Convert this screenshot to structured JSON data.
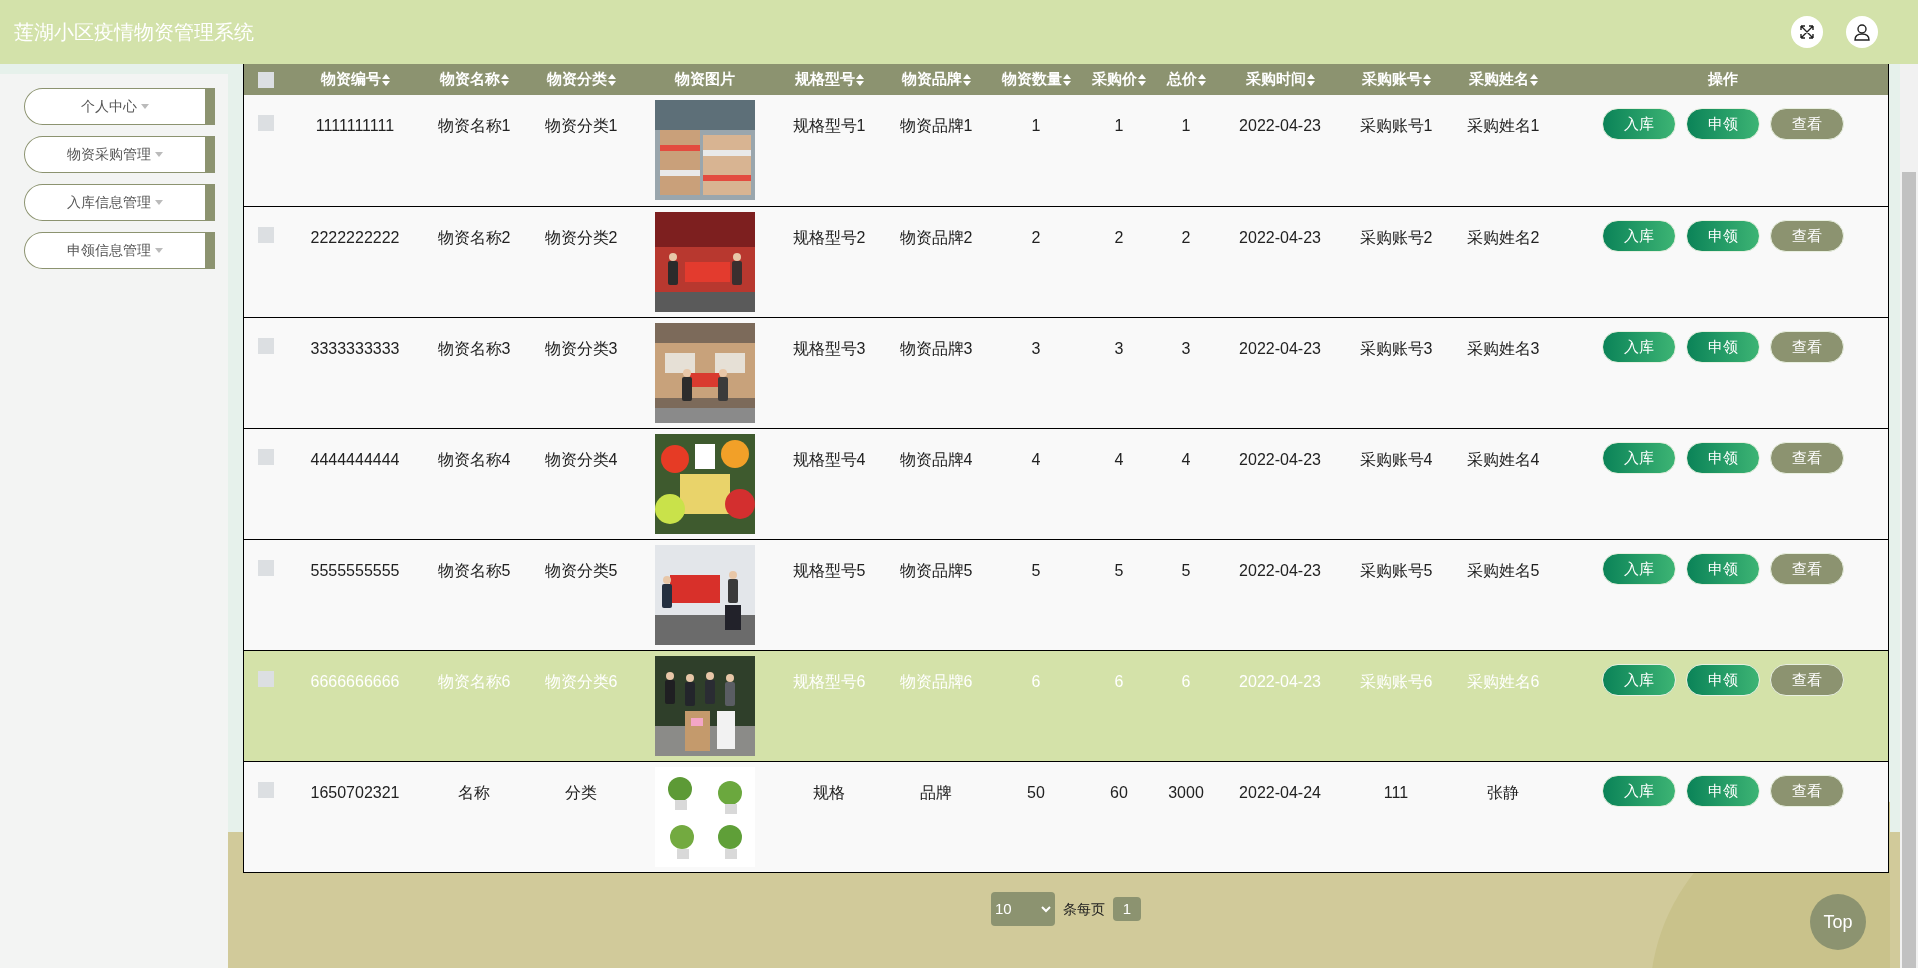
{
  "header": {
    "title": "莲湖小区疫情物资管理系统"
  },
  "sidebar": {
    "items": [
      {
        "label": "个人中心"
      },
      {
        "label": "物资采购管理"
      },
      {
        "label": "入库信息管理"
      },
      {
        "label": "申领信息管理"
      }
    ]
  },
  "table": {
    "select_all": {
      "checked": false
    },
    "columns": [
      {
        "label": "物资编号",
        "sortable": true
      },
      {
        "label": "物资名称",
        "sortable": true
      },
      {
        "label": "物资分类",
        "sortable": true
      },
      {
        "label": "物资图片",
        "sortable": false
      },
      {
        "label": "规格型号",
        "sortable": true
      },
      {
        "label": "物资品牌",
        "sortable": true
      },
      {
        "label": "物资数量",
        "sortable": true
      },
      {
        "label": "采购价",
        "sortable": true
      },
      {
        "label": "总价",
        "sortable": true
      },
      {
        "label": "采购时间",
        "sortable": true
      },
      {
        "label": "采购账号",
        "sortable": true
      },
      {
        "label": "采购姓名",
        "sortable": true
      },
      {
        "label": "操作",
        "sortable": false
      }
    ],
    "rows": [
      {
        "checked": false,
        "highlighted": false,
        "cells": [
          "1111111111",
          "物资名称1",
          "物资分类1",
          {
            "kind": "picture"
          },
          "规格型号1",
          "物资品牌1",
          "1",
          "1",
          "1",
          "2022-04-23",
          "采购账号1",
          "采购姓名1"
        ],
        "actions": [
          {
            "label": "入库",
            "kind": "primary"
          },
          {
            "label": "申领",
            "kind": "primary"
          },
          {
            "label": "查看",
            "kind": "secondary"
          }
        ]
      },
      {
        "checked": false,
        "highlighted": false,
        "cells": [
          "2222222222",
          "物资名称2",
          "物资分类2",
          {
            "kind": "picture"
          },
          "规格型号2",
          "物资品牌2",
          "2",
          "2",
          "2",
          "2022-04-23",
          "采购账号2",
          "采购姓名2"
        ],
        "actions": [
          {
            "label": "入库",
            "kind": "primary"
          },
          {
            "label": "申领",
            "kind": "primary"
          },
          {
            "label": "查看",
            "kind": "secondary"
          }
        ]
      },
      {
        "checked": false,
        "highlighted": false,
        "cells": [
          "3333333333",
          "物资名称3",
          "物资分类3",
          {
            "kind": "picture"
          },
          "规格型号3",
          "物资品牌3",
          "3",
          "3",
          "3",
          "2022-04-23",
          "采购账号3",
          "采购姓名3"
        ],
        "actions": [
          {
            "label": "入库",
            "kind": "primary"
          },
          {
            "label": "申领",
            "kind": "primary"
          },
          {
            "label": "查看",
            "kind": "secondary"
          }
        ]
      },
      {
        "checked": false,
        "highlighted": false,
        "cells": [
          "4444444444",
          "物资名称4",
          "物资分类4",
          {
            "kind": "picture"
          },
          "规格型号4",
          "物资品牌4",
          "4",
          "4",
          "4",
          "2022-04-23",
          "采购账号4",
          "采购姓名4"
        ],
        "actions": [
          {
            "label": "入库",
            "kind": "primary"
          },
          {
            "label": "申领",
            "kind": "primary"
          },
          {
            "label": "查看",
            "kind": "secondary"
          }
        ]
      },
      {
        "checked": false,
        "highlighted": false,
        "cells": [
          "5555555555",
          "物资名称5",
          "物资分类5",
          {
            "kind": "picture"
          },
          "规格型号5",
          "物资品牌5",
          "5",
          "5",
          "5",
          "2022-04-23",
          "采购账号5",
          "采购姓名5"
        ],
        "actions": [
          {
            "label": "入库",
            "kind": "primary"
          },
          {
            "label": "申领",
            "kind": "primary"
          },
          {
            "label": "查看",
            "kind": "secondary"
          }
        ]
      },
      {
        "checked": false,
        "highlighted": true,
        "cells": [
          "6666666666",
          "物资名称6",
          "物资分类6",
          {
            "kind": "picture"
          },
          "规格型号6",
          "物资品牌6",
          "6",
          "6",
          "6",
          "2022-04-23",
          "采购账号6",
          "采购姓名6"
        ],
        "actions": [
          {
            "label": "入库",
            "kind": "primary"
          },
          {
            "label": "申领",
            "kind": "primary"
          },
          {
            "label": "查看",
            "kind": "secondary"
          }
        ]
      },
      {
        "checked": false,
        "highlighted": false,
        "cells": [
          "1650702321",
          "名称",
          "分类",
          {
            "kind": "picture"
          },
          "规格",
          "品牌",
          "50",
          "60",
          "3000",
          "2022-04-24",
          "111",
          "张静"
        ],
        "actions": [
          {
            "label": "入库",
            "kind": "primary"
          },
          {
            "label": "申领",
            "kind": "primary"
          },
          {
            "label": "查看",
            "kind": "secondary"
          }
        ]
      }
    ]
  },
  "pagination": {
    "page_size": "10",
    "per_page_label": "条每页",
    "pages": [
      {
        "label": "1",
        "selected": true
      }
    ]
  },
  "top_button": "Top"
}
